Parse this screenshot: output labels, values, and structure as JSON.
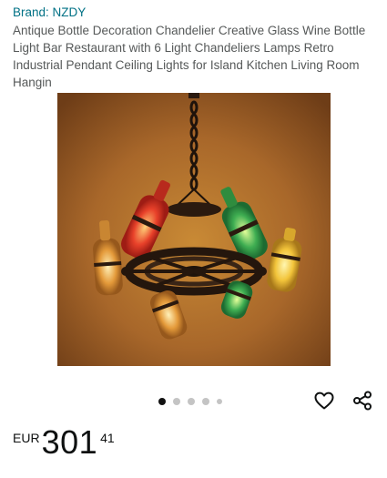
{
  "product": {
    "brand": "Brand: NZDY",
    "title": "Antique Bottle Decoration Chandelier Creative Glass Wine Bottle Light Bar Restaurant with 6 Light Chandeliers Lamps Retro Industrial Pendant Ceiling Lights for Island Kitchen Living Room Hangin",
    "image_icon": "chandelier-product-photo"
  },
  "carousel": {
    "total_dots": 5,
    "active_index": 1
  },
  "actions": {
    "wishlist_icon": "heart-icon",
    "share_icon": "share-icon"
  },
  "price": {
    "currency": "EUR",
    "whole": "301",
    "fraction": "41"
  },
  "colors": {
    "link": "#007185",
    "title_text": "#565959",
    "active_dot": "#111111",
    "inactive_dot": "#c4c4c4"
  }
}
